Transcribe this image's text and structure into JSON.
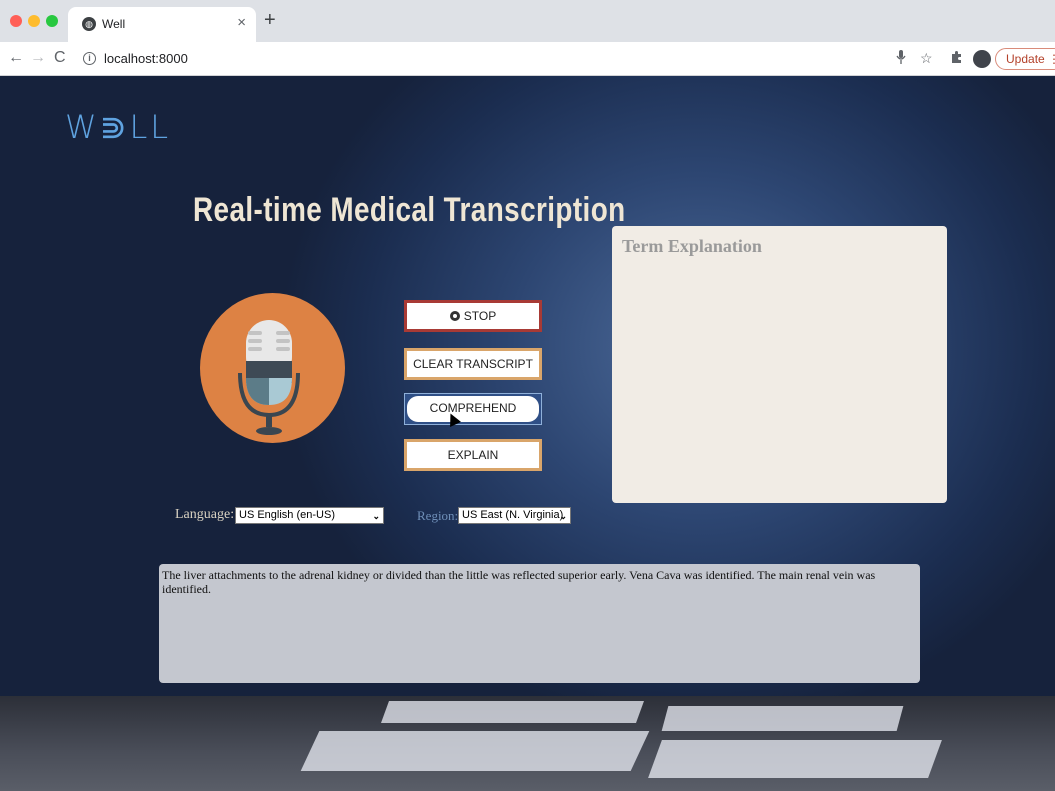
{
  "browser": {
    "tab_title": "Well",
    "tab_close": "×",
    "new_tab": "+",
    "back": "←",
    "forward": "→",
    "reload": "C",
    "url": "localhost:8000",
    "update_label": "Update",
    "update_menu": "⋮"
  },
  "app": {
    "logo": "W⋑LL",
    "headline": "Real-time Medical Transcription",
    "buttons": {
      "stop": "STOP",
      "clear": "CLEAR TRANSCRIPT",
      "comprehend": "COMPREHEND",
      "explain": "EXPLAIN"
    },
    "language": {
      "label": "Language:",
      "selected": "US English (en-US)"
    },
    "region": {
      "label": "Region:",
      "selected": "US East (N. Virginia)"
    },
    "term_panel": {
      "title": "Term Explanation"
    },
    "transcript": "The liver attachments to the adrenal kidney or divided than the little was reflected superior early. Vena Cava was identified. The main renal vein was identified."
  },
  "colors": {
    "accent_orange": "#dd8244",
    "stop_border": "#a83a35",
    "button_border": "#d9a56a",
    "logo_blue": "#5fa3e0"
  }
}
